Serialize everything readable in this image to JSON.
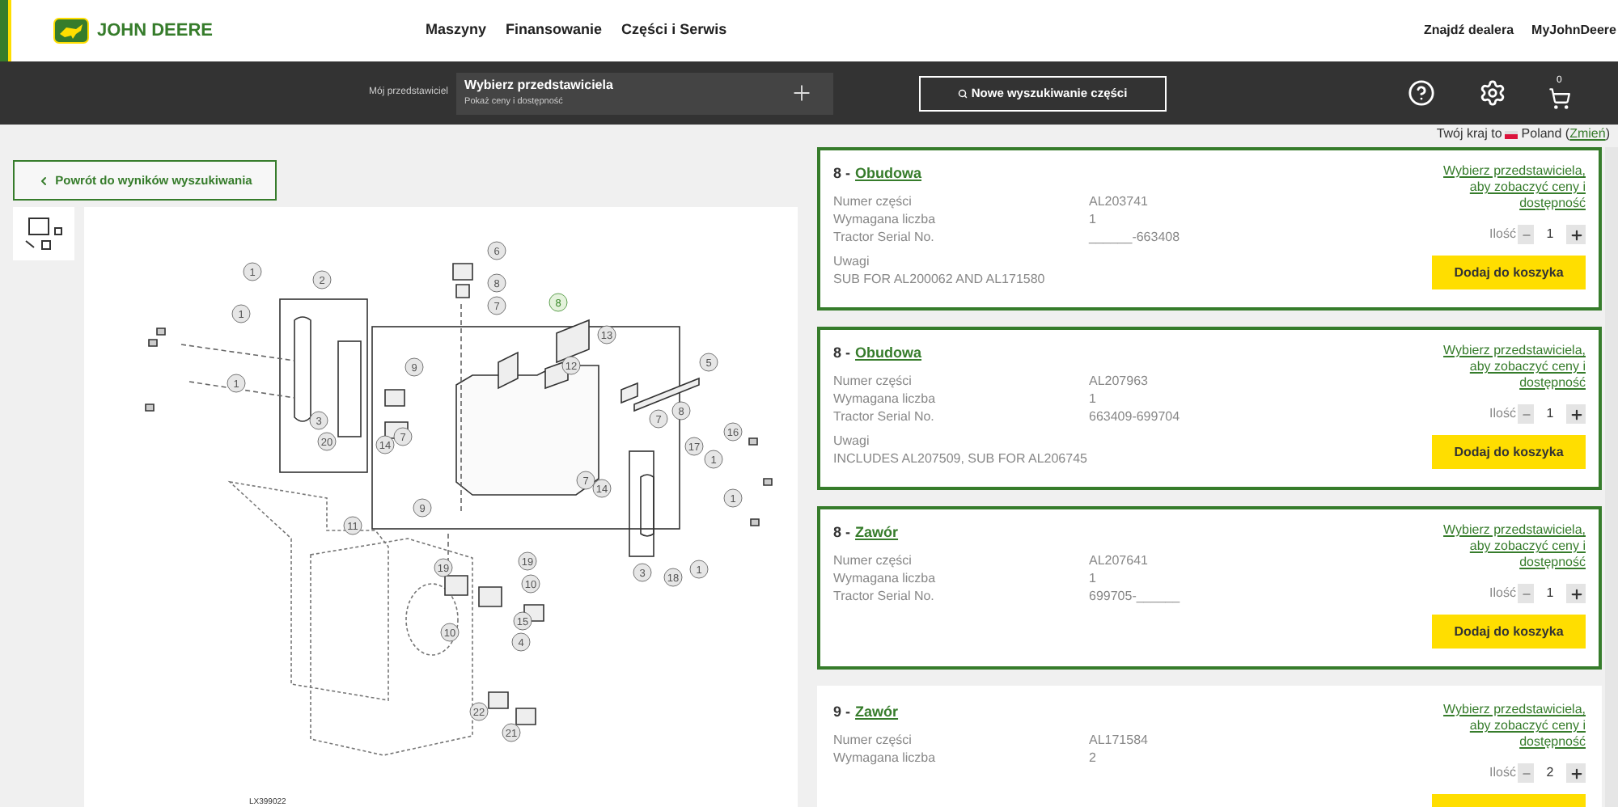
{
  "header": {
    "brand": "JOHN DEERE",
    "nav": [
      "Maszyny",
      "Finansowanie",
      "Części i Serwis"
    ],
    "links": [
      "Znajdź dealera",
      "MyJohnDeere"
    ]
  },
  "toolbar": {
    "dealer_label": "Mój przedstawiciel",
    "dealer_title": "Wybierz przedstawiciela",
    "dealer_subtitle": "Pokaż ceny i dostępność",
    "search_button": "Nowe wyszukiwanie części",
    "cart_count": "0"
  },
  "country": {
    "prefix": "Twój kraj to",
    "name": "Poland (",
    "change_link": "Zmień",
    "suffix": ")"
  },
  "back_button": "Powrót do wyników wyszukiwania",
  "diagram": {
    "code": "LX399022",
    "callouts": [
      {
        "label": "6",
        "selected": false
      },
      {
        "label": "8",
        "selected": false
      },
      {
        "label": "7",
        "selected": false
      },
      {
        "label": "8",
        "selected": true
      },
      {
        "label": "2",
        "selected": false
      },
      {
        "label": "1",
        "selected": false
      },
      {
        "label": "1",
        "selected": false
      },
      {
        "label": "1",
        "selected": false
      },
      {
        "label": "9",
        "selected": false
      },
      {
        "label": "13",
        "selected": false
      },
      {
        "label": "12",
        "selected": false
      },
      {
        "label": "5",
        "selected": false
      },
      {
        "label": "3",
        "selected": false
      },
      {
        "label": "20",
        "selected": false
      },
      {
        "label": "14",
        "selected": false
      },
      {
        "label": "7",
        "selected": false
      },
      {
        "label": "8",
        "selected": false
      },
      {
        "label": "7",
        "selected": false
      },
      {
        "label": "16",
        "selected": false
      },
      {
        "label": "17",
        "selected": false
      },
      {
        "label": "1",
        "selected": false
      },
      {
        "label": "1",
        "selected": false
      },
      {
        "label": "7",
        "selected": false
      },
      {
        "label": "14",
        "selected": false
      },
      {
        "label": "9",
        "selected": false
      },
      {
        "label": "11",
        "selected": false
      },
      {
        "label": "19",
        "selected": false
      },
      {
        "label": "19",
        "selected": false
      },
      {
        "label": "10",
        "selected": false
      },
      {
        "label": "3",
        "selected": false
      },
      {
        "label": "18",
        "selected": false
      },
      {
        "label": "1",
        "selected": false
      },
      {
        "label": "15",
        "selected": false
      },
      {
        "label": "10",
        "selected": false
      },
      {
        "label": "4",
        "selected": false
      },
      {
        "label": "22",
        "selected": false
      },
      {
        "label": "21",
        "selected": false
      }
    ]
  },
  "parts": [
    {
      "number": "8 - ",
      "name": "Obudowa",
      "highlighted": true,
      "fields": [
        {
          "label": "Numer części",
          "value": "AL203741"
        },
        {
          "label": "Wymagana liczba",
          "value": "1"
        },
        {
          "label": "Tractor Serial No.",
          "value": "______-663408"
        }
      ],
      "notes_label": "Uwagi",
      "notes": "SUB FOR AL200062 AND AL171580",
      "price_link": "Wybierz przedstawiciela, aby zobaczyć ceny i dostępność",
      "qty_label": "Ilość",
      "qty": "1",
      "button": "Dodaj do koszyka"
    },
    {
      "number": "8 - ",
      "name": "Obudowa",
      "highlighted": true,
      "fields": [
        {
          "label": "Numer części",
          "value": "AL207963"
        },
        {
          "label": "Wymagana liczba",
          "value": "1"
        },
        {
          "label": "Tractor Serial No.",
          "value": "663409-699704"
        }
      ],
      "notes_label": "Uwagi",
      "notes": "INCLUDES AL207509, SUB FOR AL206745",
      "price_link": "Wybierz przedstawiciela, aby zobaczyć ceny i dostępność",
      "qty_label": "Ilość",
      "qty": "1",
      "button": "Dodaj do koszyka"
    },
    {
      "number": "8 - ",
      "name": "Zawór",
      "highlighted": true,
      "fields": [
        {
          "label": "Numer części",
          "value": "AL207641"
        },
        {
          "label": "Wymagana liczba",
          "value": "1"
        },
        {
          "label": "Tractor Serial No.",
          "value": "699705-______"
        }
      ],
      "price_link": "Wybierz przedstawiciela, aby zobaczyć ceny i dostępność",
      "qty_label": "Ilość",
      "qty": "1",
      "button": "Dodaj do koszyka"
    },
    {
      "number": "9 - ",
      "name": "Zawór",
      "highlighted": false,
      "fields": [
        {
          "label": "Numer części",
          "value": "AL171584"
        },
        {
          "label": "Wymagana liczba",
          "value": "2"
        }
      ],
      "price_link": "Wybierz przedstawiciela, aby zobaczyć ceny i dostępność",
      "qty_label": "Ilość",
      "qty": "2"
    }
  ]
}
